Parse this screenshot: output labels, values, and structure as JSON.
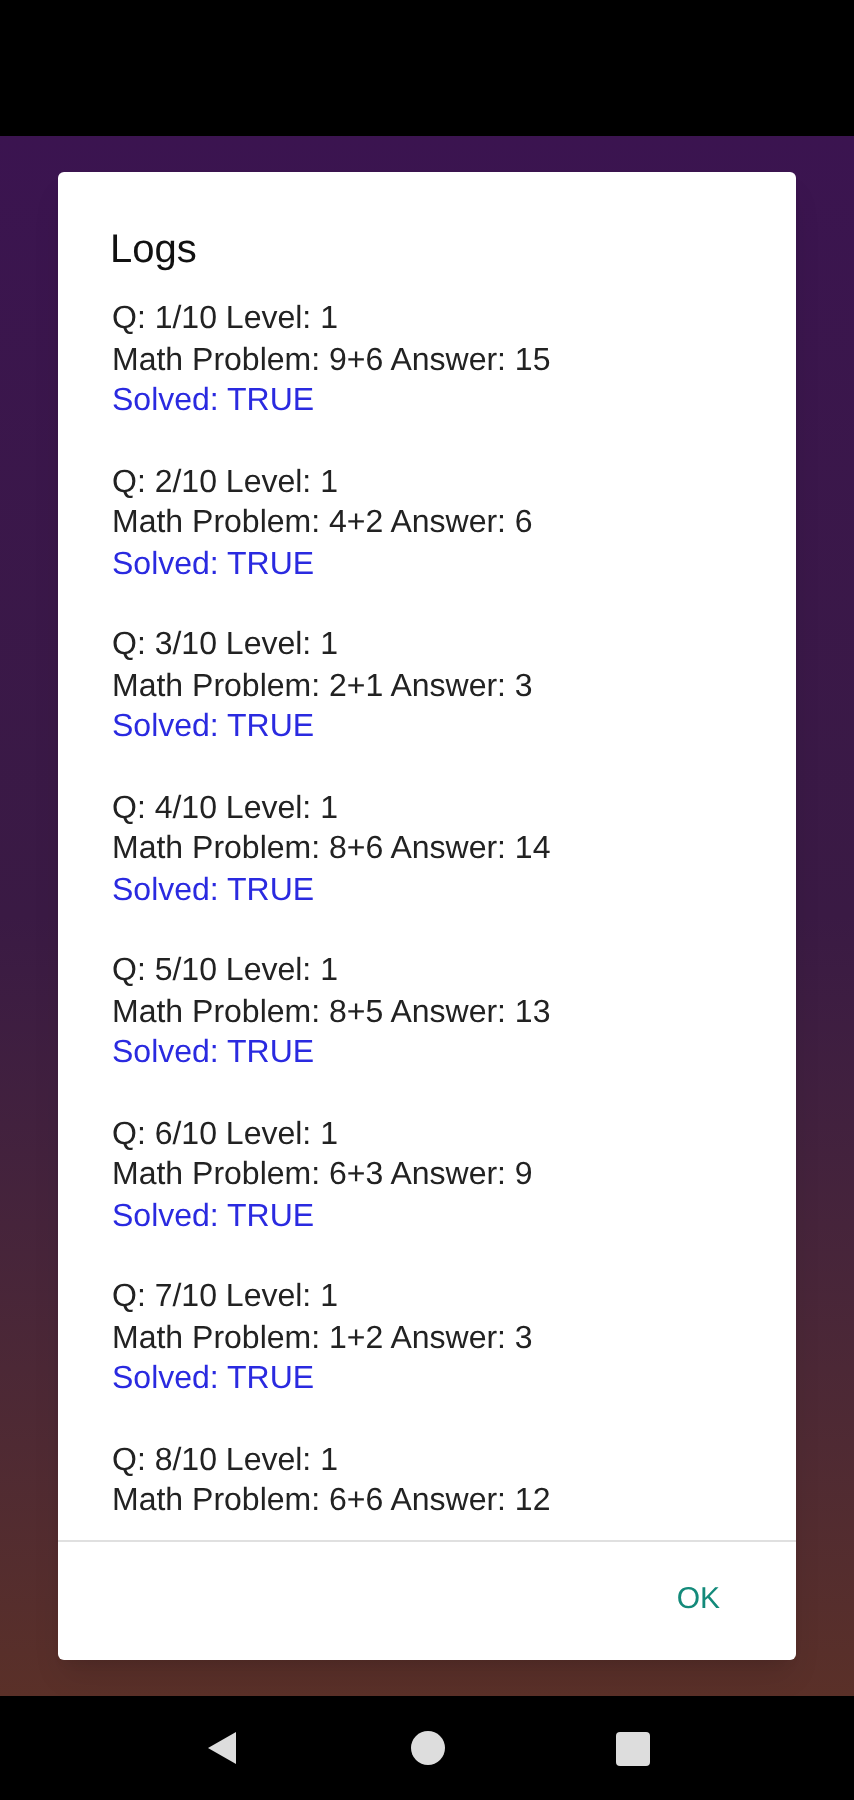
{
  "dialog": {
    "title": "Logs",
    "entries": [
      {
        "question": "Q: 1/10 Level: 1",
        "problem": "Math Problem: 9+6 Answer: 15",
        "result": "Solved: TRUE"
      },
      {
        "question": "Q: 2/10 Level: 1",
        "problem": "Math Problem: 4+2 Answer: 6",
        "result": "Solved: TRUE"
      },
      {
        "question": "Q: 3/10 Level: 1",
        "problem": "Math Problem: 2+1 Answer: 3",
        "result": "Solved: TRUE"
      },
      {
        "question": "Q: 4/10 Level: 1",
        "problem": "Math Problem: 8+6 Answer: 14",
        "result": "Solved: TRUE"
      },
      {
        "question": "Q: 5/10 Level: 1",
        "problem": "Math Problem: 8+5 Answer: 13",
        "result": "Solved: TRUE"
      },
      {
        "question": "Q: 6/10 Level: 1",
        "problem": "Math Problem: 6+3 Answer: 9",
        "result": "Solved: TRUE"
      },
      {
        "question": "Q: 7/10 Level: 1",
        "problem": "Math Problem: 1+2 Answer: 3",
        "result": "Solved: TRUE"
      },
      {
        "question": "Q: 8/10 Level: 1",
        "problem": "Math Problem: 6+6 Answer: 12"
      }
    ],
    "button": "OK"
  }
}
